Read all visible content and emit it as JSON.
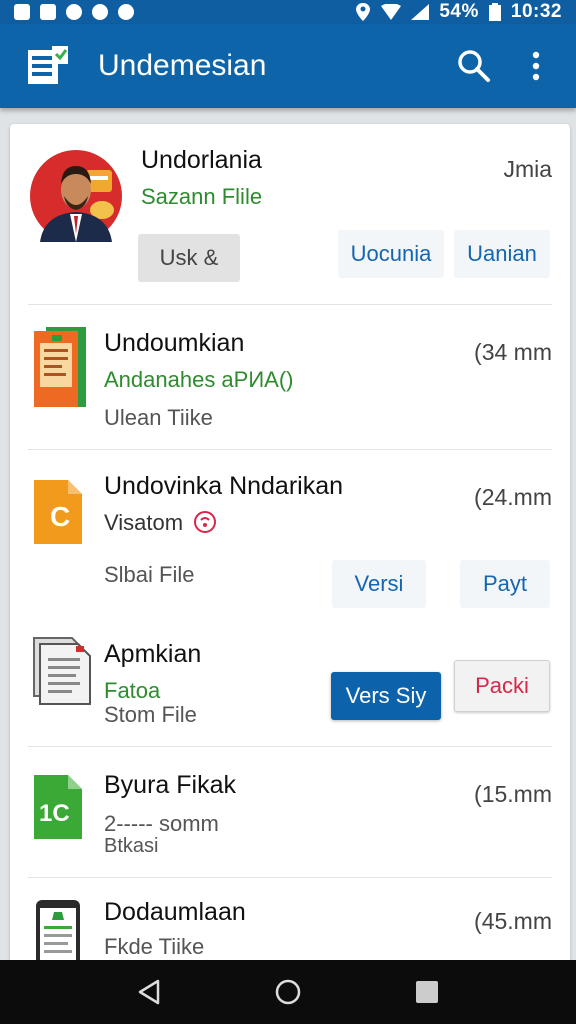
{
  "status_bar": {
    "battery": "54%",
    "time": "10:32"
  },
  "app_bar": {
    "title": "Undemesian",
    "icons": [
      "app-logo-icon",
      "search-icon",
      "more-vert-icon"
    ]
  },
  "items": [
    {
      "title": "Undorlania",
      "subtitle": "Sazann Flile",
      "meta": "Jmia",
      "thumb": "avatar",
      "buttons": [
        "Usk &",
        "Uocunia",
        "Uanian"
      ]
    },
    {
      "title": "Undoumkian",
      "subtitle": "Andanahes aPИА()",
      "detail": "Ulean Tiike",
      "meta": "(34 mm",
      "thumb": "document-icon-orange"
    },
    {
      "title": "Undovinka Nndarikan",
      "subtitle": "Visatom",
      "detail": "Slbai File",
      "meta": "(24.mm",
      "thumb": "file-c-icon",
      "buttons": [
        "Versi",
        "Payt"
      ]
    },
    {
      "title": "Apmkian",
      "subtitle": "Fatoa",
      "detail": "Stom File",
      "thumb": "folder-icon",
      "buttons": [
        "Vers Siy",
        "Packi"
      ]
    },
    {
      "title": "Byura Fikak",
      "subtitle": "2----- somm",
      "detail": "Btkasi",
      "meta": "(15.mm",
      "thumb": "file-1c-icon"
    },
    {
      "title": "Dodaumlaan",
      "detail": "Fkde Tiike",
      "meta": "(45.mm",
      "thumb": "phone-doc-icon"
    }
  ],
  "colors": {
    "app_bar": "#0e64a8",
    "status_bar": "#0f5ea1",
    "green_text": "#2e8b2e",
    "primary_button": "#0d63ab",
    "danger_text": "#d6284b"
  }
}
